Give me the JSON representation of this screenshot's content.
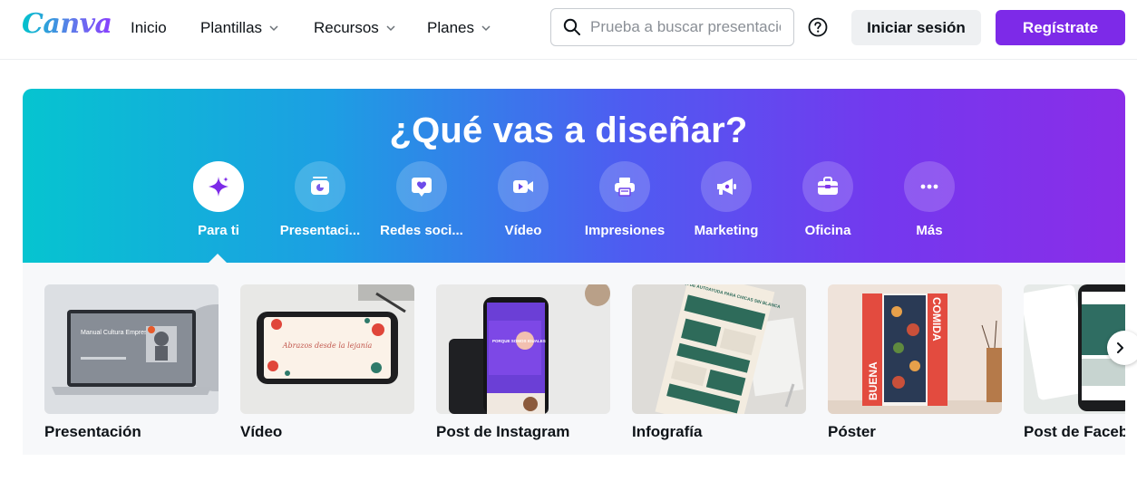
{
  "header": {
    "logo": "Canva",
    "nav": [
      {
        "label": "Inicio",
        "has_dropdown": false
      },
      {
        "label": "Plantillas",
        "has_dropdown": true
      },
      {
        "label": "Recursos",
        "has_dropdown": true
      },
      {
        "label": "Planes",
        "has_dropdown": true
      }
    ],
    "search_placeholder": "Prueba a buscar presentaciones",
    "login_label": "Iniciar sesión",
    "signup_label": "Regístrate"
  },
  "hero": {
    "title": "¿Qué vas a diseñar?",
    "categories": [
      {
        "label": "Para ti",
        "icon": "sparkle-icon",
        "active": true
      },
      {
        "label": "Presentaci...",
        "icon": "presentation-icon",
        "active": false
      },
      {
        "label": "Redes soci...",
        "icon": "heart-chat-icon",
        "active": false
      },
      {
        "label": "Vídeo",
        "icon": "video-camera-icon",
        "active": false
      },
      {
        "label": "Impresiones",
        "icon": "printer-icon",
        "active": false
      },
      {
        "label": "Marketing",
        "icon": "megaphone-icon",
        "active": false
      },
      {
        "label": "Oficina",
        "icon": "briefcase-icon",
        "active": false
      },
      {
        "label": "Más",
        "icon": "more-dots-icon",
        "active": false
      }
    ]
  },
  "cards": [
    {
      "label": "Presentación",
      "thumb_text": "Manual Cultura Empresarial"
    },
    {
      "label": "Vídeo",
      "thumb_text": "Abrazos desde la lejanía"
    },
    {
      "label": "Post de Instagram",
      "thumb_text": "PORQUE SOMOS IGUALES"
    },
    {
      "label": "Infografía",
      "thumb_text": "GUÍA DE AUTOAYUDA PARA CHICAS SIN BLANCA"
    },
    {
      "label": "Póster",
      "thumb_text": "BUENA COMIDA"
    },
    {
      "label": "Post de Faceb",
      "thumb_text": ""
    }
  ],
  "colors": {
    "brand_purple": "#7d2ae8",
    "hero_gradient_start": "#06c4d0",
    "hero_gradient_end": "#8a2de8",
    "panel_bg": "#f7f8fa"
  }
}
